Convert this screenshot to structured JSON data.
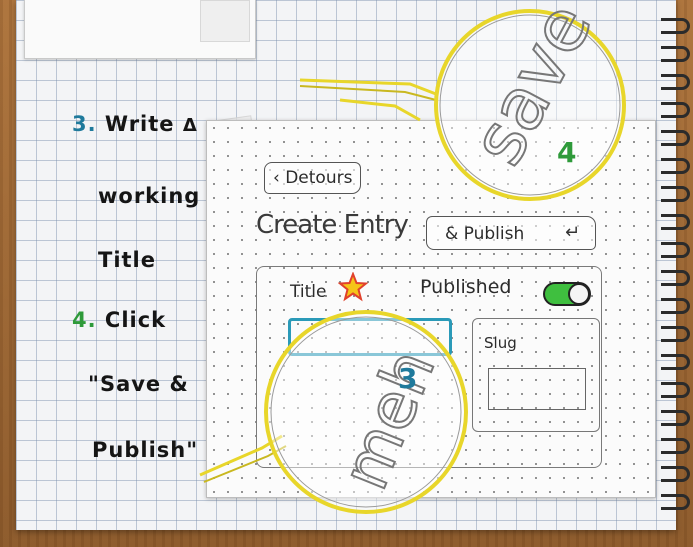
{
  "notes": {
    "step3_number": "3.",
    "step3_line1": "Write",
    "step3_line1_symbol": "Δ",
    "step3_line2": "working",
    "step3_line3": "Title",
    "step4_number": "4.",
    "step4_line1": "Click",
    "step4_line2": "\"Save &",
    "step4_line3": "Publish\""
  },
  "mockup": {
    "back_link": "‹ Detours",
    "page_title": "Create Entry",
    "publish_button": "& Publish",
    "title_label": "Title",
    "published_label": "Published",
    "slug_label": "Slug",
    "published_toggle_on": true
  },
  "callouts": {
    "top_marker": "4",
    "top_letters": "save",
    "bottom_marker": "3",
    "bottom_letters": "meh"
  },
  "colors": {
    "step3_accent": "#1f7a9c",
    "step4_accent": "#2e9a3a",
    "callout_ring": "#e8d62a",
    "toggle_on": "#3fbf3f",
    "star_fill": "#f5c518",
    "star_outline": "#e0412c",
    "title_field_border": "#2a9ab8"
  },
  "icons": {
    "return": "return-arrow-icon",
    "star": "star-icon"
  }
}
